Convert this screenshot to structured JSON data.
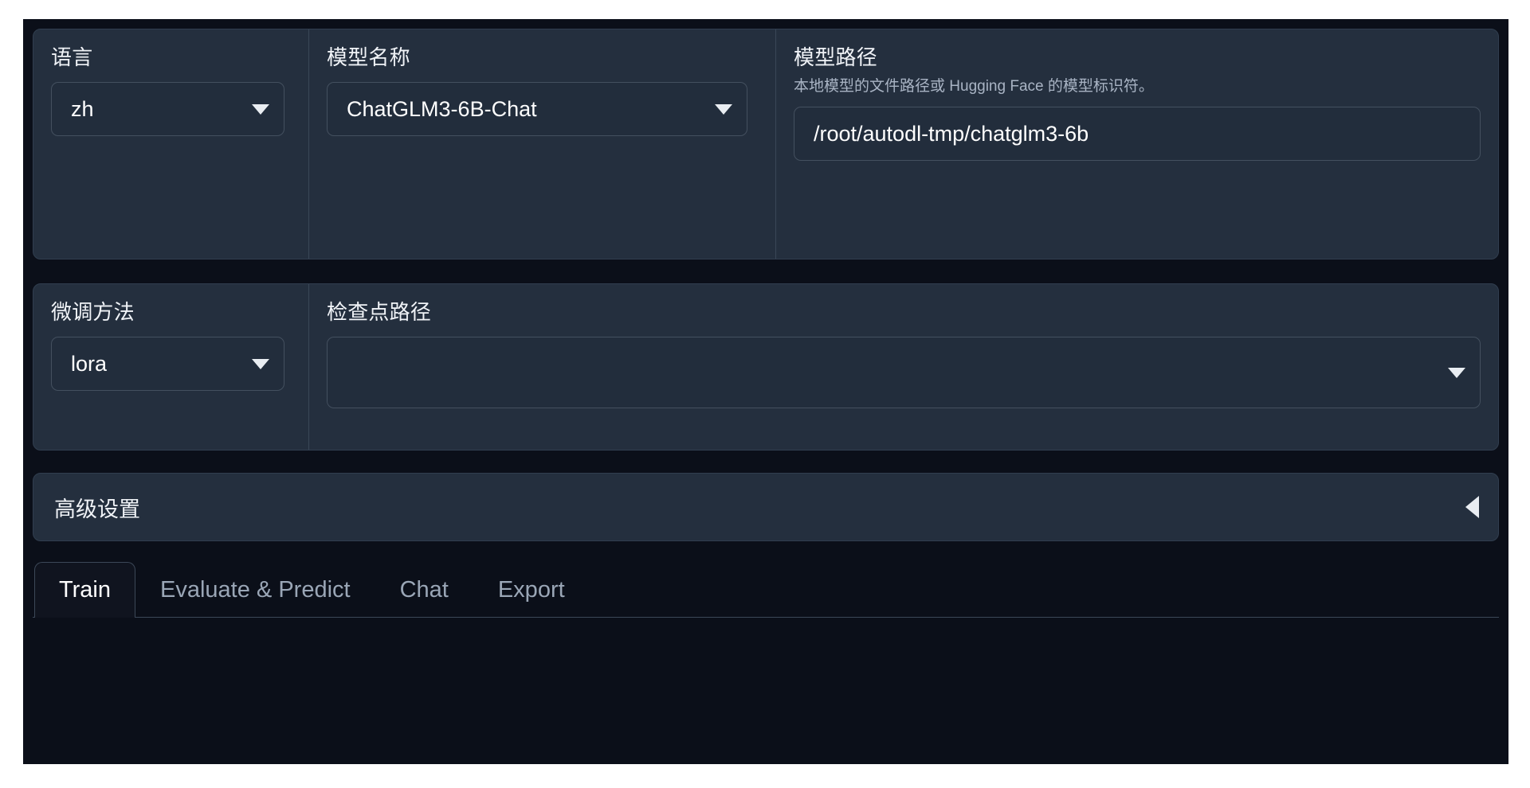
{
  "theme": {
    "page_background": "#ffffff",
    "app_background": "#0b0f19",
    "panel_background": "#242f3e",
    "control_background": "#222d3c",
    "border_color": "#313e4f",
    "control_border": "#44505f",
    "text_primary": "#ffffff",
    "text_secondary": "#a9b4c4",
    "tab_active_background": "#10141f",
    "tab_inactive_text": "#9aa6b6"
  },
  "top_section": {
    "language": {
      "label": "语言",
      "value": "zh",
      "dropdown_icon": "chevron-down-icon"
    },
    "model_name": {
      "label": "模型名称",
      "value": "ChatGLM3-6B-Chat",
      "dropdown_icon": "chevron-down-icon"
    },
    "model_path": {
      "label": "模型路径",
      "info": "本地模型的文件路径或 Hugging Face 的模型标识符。",
      "value": "/root/autodl-tmp/chatglm3-6b",
      "placeholder": ""
    }
  },
  "second_section": {
    "finetuning_method": {
      "label": "微调方法",
      "value": "lora",
      "dropdown_icon": "chevron-down-icon"
    },
    "checkpoint_path": {
      "label": "检查点路径",
      "value": "",
      "placeholder": "",
      "dropdown_icon": "chevron-down-icon"
    }
  },
  "accordion": {
    "title": "高级设置",
    "expanded": false,
    "toggle_icon": "chevron-left-icon"
  },
  "tabs": {
    "active_index": 0,
    "items": [
      {
        "label": "Train"
      },
      {
        "label": "Evaluate & Predict"
      },
      {
        "label": "Chat"
      },
      {
        "label": "Export"
      }
    ]
  }
}
